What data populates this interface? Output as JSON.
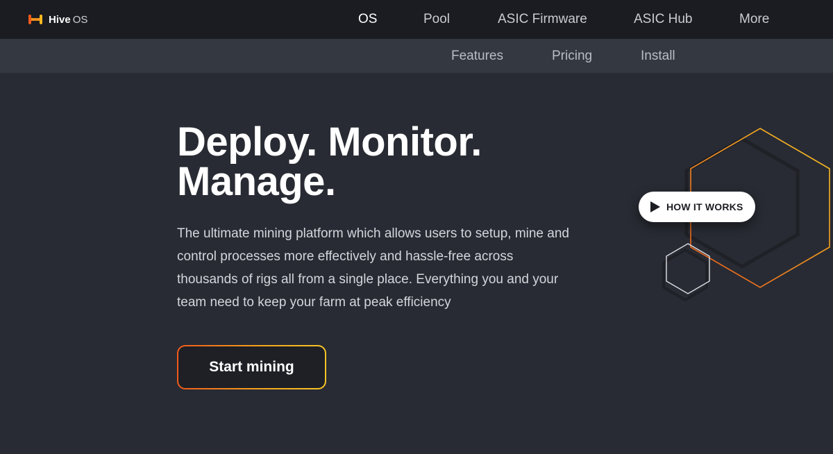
{
  "brand": {
    "name": "Hive",
    "suffix": "OS",
    "accent": "#f7931e"
  },
  "main_nav": [
    {
      "label": "OS",
      "active": true
    },
    {
      "label": "Pool",
      "active": false
    },
    {
      "label": "ASIC Firmware",
      "active": false
    },
    {
      "label": "ASIC Hub",
      "active": false
    },
    {
      "label": "More",
      "active": false
    }
  ],
  "sub_nav": [
    {
      "label": "Features"
    },
    {
      "label": "Pricing"
    },
    {
      "label": "Install"
    }
  ],
  "hero": {
    "title_line1": "Deploy. Monitor.",
    "title_line2": "Manage.",
    "description": "The ultimate mining platform which allows users to setup, mine and control processes more effectively and hassle-free across thousands of rigs all from a single place. Everything you and your team need to keep your farm at peak efficiency",
    "cta_label": "Start mining",
    "video_label": "HOW IT WORKS"
  },
  "colors": {
    "background": "#282b33",
    "topbar": "#1a1c21",
    "subbar": "#343840",
    "gradient_start": "#f05a1a",
    "gradient_end": "#f8c626"
  },
  "icons": {
    "logo": "hive-logo-icon",
    "play": "play-icon"
  }
}
